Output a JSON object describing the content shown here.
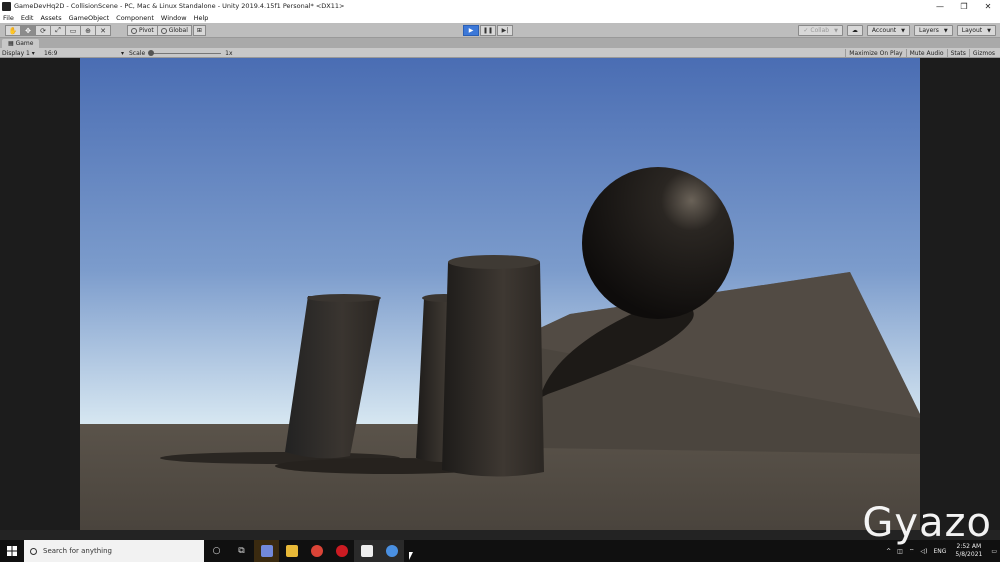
{
  "window": {
    "title": "GameDevHq2D - CollisionScene - PC, Mac & Linux Standalone - Unity 2019.4.15f1 Personal* <DX11>",
    "minimize": "—",
    "maximize": "❐",
    "close": "✕"
  },
  "menu": [
    "File",
    "Edit",
    "Assets",
    "GameObject",
    "Component",
    "Window",
    "Help"
  ],
  "toolbar": {
    "pivot_label": "Pivot",
    "global_label": "Global",
    "collab_label": "Collab",
    "account_label": "Account",
    "layers_label": "Layers",
    "layout_label": "Layout"
  },
  "game_tab": {
    "tab_label": "Game",
    "display_label": "Display 1",
    "aspect_label": "16:9",
    "scale_label": "Scale",
    "scale_value": "1x",
    "maximize_label": "Maximize On Play",
    "mute_label": "Mute Audio",
    "stats_label": "Stats",
    "gizmos_label": "Gizmos"
  },
  "taskbar": {
    "search_placeholder": "Search for anything",
    "language": "ENG",
    "time": "2:52 AM",
    "date": "5/8/2021"
  },
  "watermark": "Gyazo",
  "colors": {
    "sky_top": "#4a6db3",
    "sky_horizon": "#d8e8f2",
    "ground": "#514a42",
    "play_active": "#3c78d8"
  }
}
